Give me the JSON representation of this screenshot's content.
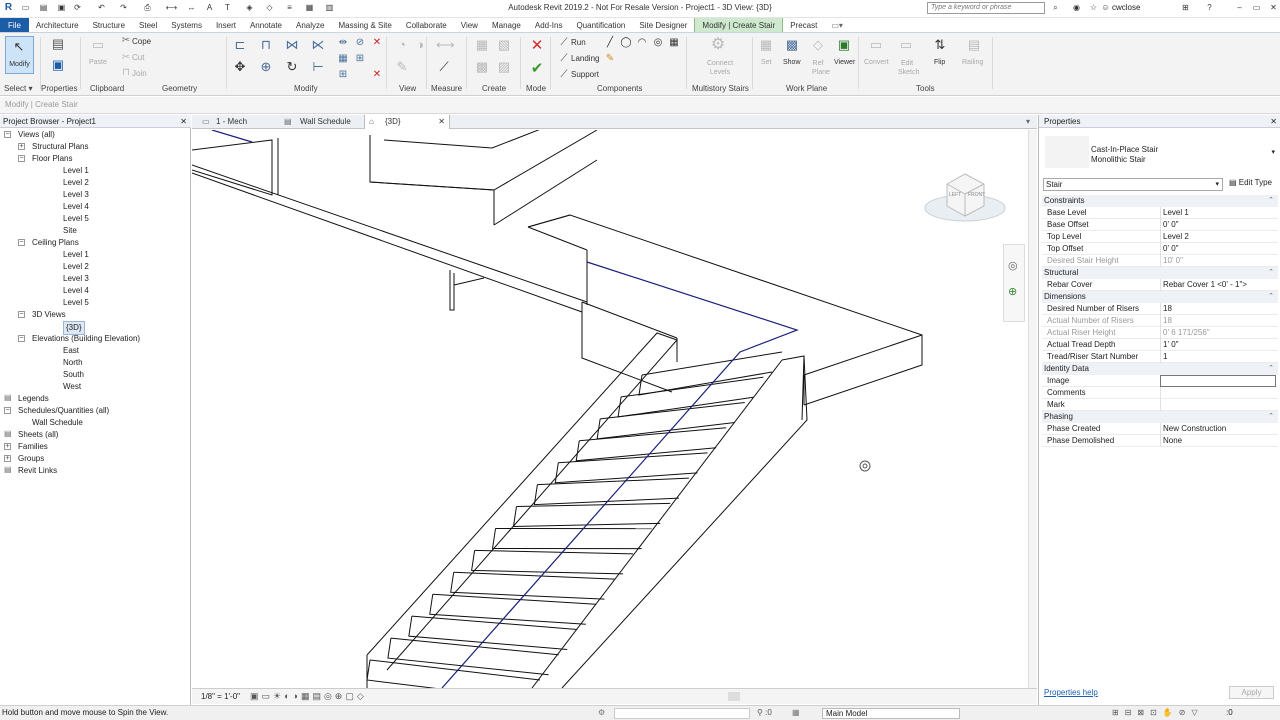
{
  "window": {
    "title": "Autodesk Revit 2019.2 - Not For Resale Version - Project1 - 3D View: {3D}",
    "search_placeholder": "Type a keyword or phrase",
    "user": "cwclose"
  },
  "ribbon_tabs": [
    {
      "label": "File",
      "kind": "file"
    },
    {
      "label": "Architecture"
    },
    {
      "label": "Structure"
    },
    {
      "label": "Steel"
    },
    {
      "label": "Systems"
    },
    {
      "label": "Insert"
    },
    {
      "label": "Annotate"
    },
    {
      "label": "Analyze"
    },
    {
      "label": "Massing & Site"
    },
    {
      "label": "Collaborate"
    },
    {
      "label": "View"
    },
    {
      "label": "Manage"
    },
    {
      "label": "Add-Ins"
    },
    {
      "label": "Quantification"
    },
    {
      "label": "Site Designer"
    },
    {
      "label": "Modify | Create Stair",
      "kind": "ctx"
    },
    {
      "label": "Precast"
    }
  ],
  "ribbon": {
    "panels": [
      "Select",
      "Properties",
      "Clipboard",
      "Geometry",
      "Modify",
      "View",
      "Measure",
      "Create",
      "Mode",
      "Components",
      "Multistory Stairs",
      "Work Plane",
      "Tools"
    ],
    "buttons": {
      "modify": "Modify",
      "paste": "Paste",
      "cope": "Cope",
      "cut": "Cut",
      "join": "Join",
      "run": "Run",
      "landing": "Landing",
      "support": "Support",
      "connect_levels": "Connect Levels",
      "set": "Set",
      "show": "Show",
      "ref_plane": "Ref Plane",
      "viewer": "Viewer",
      "convert": "Convert",
      "edit_sketch": "Edit Sketch",
      "flip": "Flip",
      "railing": "Railing"
    }
  },
  "options_bar": "Modify | Create Stair",
  "project_browser": {
    "title": "Project Browser - Project1",
    "items": [
      {
        "label": "Views (all)",
        "level": 0,
        "toggle": "-"
      },
      {
        "label": "Structural Plans",
        "level": 1,
        "toggle": "+"
      },
      {
        "label": "Floor Plans",
        "level": 1,
        "toggle": "-"
      },
      {
        "label": "Level 1",
        "level": 2
      },
      {
        "label": "Level 2",
        "level": 2
      },
      {
        "label": "Level 3",
        "level": 2
      },
      {
        "label": "Level 4",
        "level": 2
      },
      {
        "label": "Level 5",
        "level": 2
      },
      {
        "label": "Site",
        "level": 2
      },
      {
        "label": "Ceiling Plans",
        "level": 1,
        "toggle": "-"
      },
      {
        "label": "Level 1",
        "level": 2
      },
      {
        "label": "Level 2",
        "level": 2
      },
      {
        "label": "Level 3",
        "level": 2
      },
      {
        "label": "Level 4",
        "level": 2
      },
      {
        "label": "Level 5",
        "level": 2
      },
      {
        "label": "3D Views",
        "level": 1,
        "toggle": "-"
      },
      {
        "label": "{3D}",
        "level": 2,
        "selected": true
      },
      {
        "label": "Elevations (Building Elevation)",
        "level": 1,
        "toggle": "-"
      },
      {
        "label": "East",
        "level": 2
      },
      {
        "label": "North",
        "level": 2
      },
      {
        "label": "South",
        "level": 2
      },
      {
        "label": "West",
        "level": 2
      },
      {
        "label": "Legends",
        "level": 0,
        "toggle": ""
      },
      {
        "label": "Schedules/Quantities (all)",
        "level": 0,
        "toggle": "-"
      },
      {
        "label": "Wall Schedule",
        "level": 1
      },
      {
        "label": "Sheets (all)",
        "level": 0,
        "toggle": ""
      },
      {
        "label": "Families",
        "level": 0,
        "toggle": "+"
      },
      {
        "label": "Groups",
        "level": 0,
        "toggle": "+"
      },
      {
        "label": "Revit Links",
        "level": 0,
        "toggle": ""
      }
    ]
  },
  "view_tabs": [
    {
      "label": "1 - Mech"
    },
    {
      "label": "Wall Schedule"
    },
    {
      "label": "{3D}",
      "active": true
    }
  ],
  "viewcube": {
    "left": "LEFT",
    "front": "FRONT"
  },
  "view_scale": "1/8\" = 1'-0\"",
  "properties": {
    "title": "Properties",
    "type_line1": "Cast-In-Place Stair",
    "type_line2": "Monolithic Stair",
    "family_selector": "Stair",
    "edit_type": "Edit Type",
    "groups": [
      {
        "name": "Constraints",
        "rows": [
          {
            "k": "Base Level",
            "v": "Level 1"
          },
          {
            "k": "Base Offset",
            "v": "0'  0\""
          },
          {
            "k": "Top Level",
            "v": "Level 2"
          },
          {
            "k": "Top Offset",
            "v": "0'  0\""
          },
          {
            "k": "Desired Stair Height",
            "v": "10'  0\"",
            "gray": true
          }
        ]
      },
      {
        "name": "Structural",
        "rows": [
          {
            "k": "Rebar Cover",
            "v": "Rebar Cover 1 <0' - 1\">"
          }
        ]
      },
      {
        "name": "Dimensions",
        "rows": [
          {
            "k": "Desired Number of Risers",
            "v": "18"
          },
          {
            "k": "Actual Number of Risers",
            "v": "18",
            "gray": true
          },
          {
            "k": "Actual Riser Height",
            "v": "0'  6 171/256\"",
            "gray": true
          },
          {
            "k": "Actual Tread Depth",
            "v": "1'  0\""
          },
          {
            "k": "Tread/Riser Start Number",
            "v": "1"
          }
        ]
      },
      {
        "name": "Identity Data",
        "rows": [
          {
            "k": "Image",
            "v": ""
          },
          {
            "k": "Comments",
            "v": ""
          },
          {
            "k": "Mark",
            "v": ""
          }
        ]
      },
      {
        "name": "Phasing",
        "rows": [
          {
            "k": "Phase Created",
            "v": "New Construction"
          },
          {
            "k": "Phase Demolished",
            "v": "None"
          }
        ]
      }
    ],
    "help": "Properties help",
    "apply": "Apply"
  },
  "status": {
    "text": "Hold button and move mouse to Spin the View.",
    "selection_count": ":0",
    "model": "Main Model"
  }
}
